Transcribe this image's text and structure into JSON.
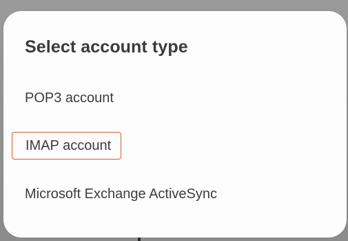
{
  "dialog": {
    "title": "Select account type",
    "options": [
      {
        "label": "POP3 account"
      },
      {
        "label": "IMAP account",
        "highlighted": true
      },
      {
        "label": "Microsoft Exchange ActiveSync"
      }
    ]
  },
  "colors": {
    "highlight_border": "#d9582b",
    "dialog_background": "#fdfdfd",
    "backdrop": "#8f8f8f"
  }
}
